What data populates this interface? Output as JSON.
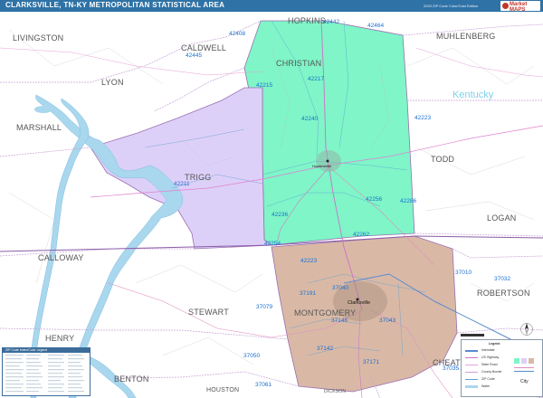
{
  "header": {
    "title": "CLARKSVILLE, TN-KY METROPOLITAN STATISTICAL AREA",
    "edition": "2023 ZIP Code Color/Cast Edition",
    "logo": "Market MAPS"
  },
  "counties": {
    "livingston": "LIVINGSTON",
    "caldwell": "CALDWELL",
    "hopkins": "HOPKINS",
    "muhlenberg": "MUHLENBERG",
    "lyon": "LYON",
    "christian": "CHRISTIAN",
    "marshall": "MARSHALL",
    "trigg": "TRIGG",
    "todd": "TODD",
    "logan": "LOGAN",
    "calloway": "CALLOWAY",
    "stewart": "STEWART",
    "montgomery": "MONTGOMERY",
    "robertson": "ROBERTSON",
    "henry": "HENRY",
    "benton": "BENTON",
    "houston": "HOUSTON",
    "dickson": "DICKSON",
    "cheatham": "CHEATHAM"
  },
  "state_label": "Kentucky",
  "cities": {
    "hopkinsville": "Hopkinsville",
    "clarksville": "Clarksville"
  },
  "zips": [
    "42408",
    "42442",
    "42464",
    "42445",
    "42215",
    "42217",
    "42240",
    "42223",
    "42211",
    "42256",
    "42286",
    "42236",
    "42254",
    "42262",
    "42223",
    "37010",
    "37032",
    "37191",
    "37040",
    "37079",
    "37043",
    "37146",
    "37142",
    "37171",
    "37050",
    "37035",
    "37061"
  ],
  "legend": {
    "title": "ZIP Code Index/Color Legend"
  },
  "key": {
    "title": "Legend",
    "items": [
      "Interstate",
      "US Highway",
      "State Road",
      "County Border",
      "ZIP Code",
      "Water"
    ],
    "city_symbol": "City"
  },
  "colors": {
    "header": "#2f72a6",
    "christian": "#7ff5c8",
    "trigg": "#ddd0f8",
    "montgomery": "#d9b9a6",
    "water": "#a9d7ee",
    "zip_label": "#1b6fd0",
    "county_label": "#555555"
  }
}
